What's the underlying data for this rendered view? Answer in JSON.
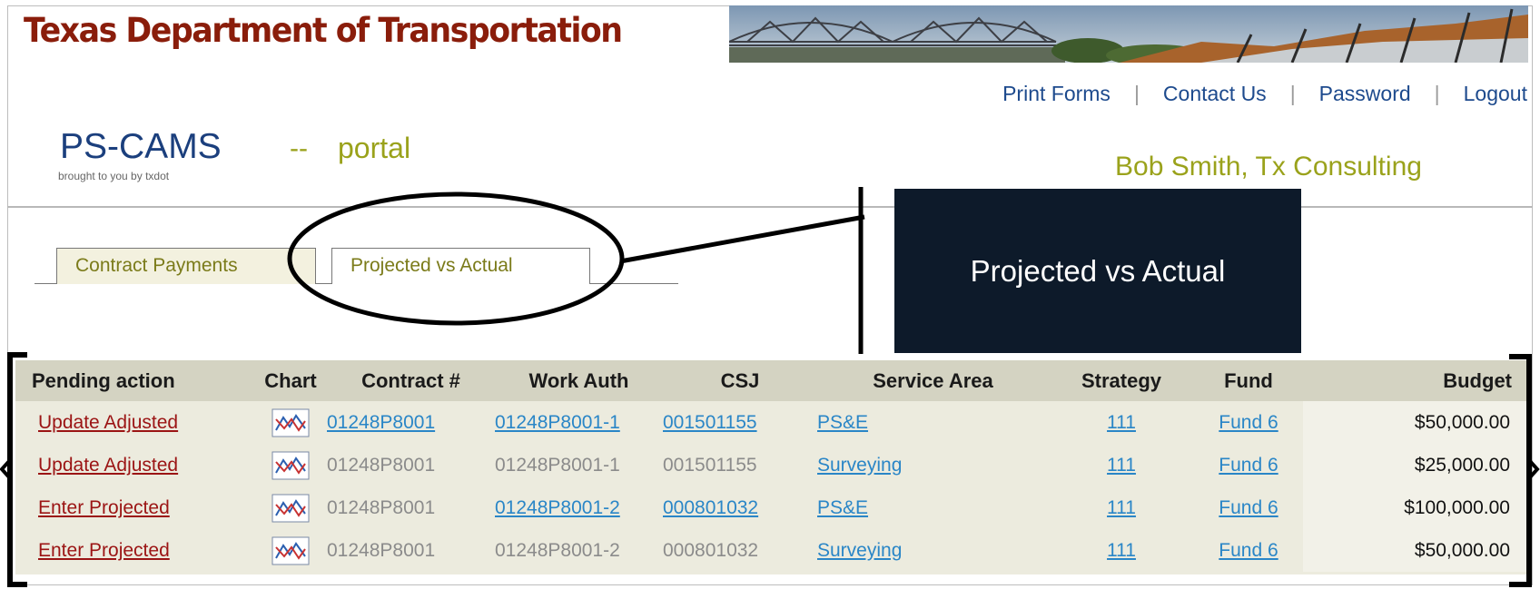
{
  "header": {
    "agency_title": "Texas Department of Transportation",
    "links": [
      "Print Forms",
      "Contact Us",
      "Password",
      "Logout"
    ],
    "app_name": "PS-CAMS",
    "app_dash": "--",
    "app_suffix": "portal",
    "app_subtitle": "brought to you by txdot",
    "user": "Bob Smith, Tx Consulting"
  },
  "tabs": [
    {
      "label": "Contract Payments",
      "active": false
    },
    {
      "label": "Projected vs Actual",
      "active": true
    }
  ],
  "callout": {
    "label": "Projected vs Actual"
  },
  "table": {
    "columns": [
      "Pending action",
      "Chart",
      "Contract #",
      "Work Auth",
      "CSJ",
      "Service Area",
      "Strategy",
      "Fund",
      "Budget"
    ],
    "rows": [
      {
        "action": "Update Adjusted",
        "contract": "01248P8001",
        "work_auth": "01248P8001-1",
        "csj": "001501155",
        "service_area": "PS&E",
        "strategy": "111",
        "fund": "Fund 6",
        "budget": "$50,000.00"
      },
      {
        "action": "Update Adjusted",
        "contract": "01248P8001",
        "work_auth": "01248P8001-1",
        "csj": "001501155",
        "service_area": "Surveying",
        "strategy": "111",
        "fund": "Fund 6",
        "budget": "$25,000.00"
      },
      {
        "action": "Enter Projected",
        "contract": "01248P8001",
        "work_auth": "01248P8001-2",
        "csj": "000801032",
        "service_area": "PS&E",
        "strategy": "111",
        "fund": "Fund 6",
        "budget": "$100,000.00"
      },
      {
        "action": "Enter Projected",
        "contract": "01248P8001",
        "work_auth": "01248P8001-2",
        "csj": "000801032",
        "service_area": "Surveying",
        "strategy": "111",
        "fund": "Fund 6",
        "budget": "$50,000.00"
      }
    ]
  },
  "icons": {
    "chart": "line-chart-icon"
  },
  "colors": {
    "agency_title": "#8a1d0b",
    "link_blue": "#2a86c7",
    "link_red": "#9b1414",
    "olive": "#9aa21b",
    "callout_bg": "#0d1a2a",
    "header_row": "#d4d3c2",
    "table_bg": "#ecebde"
  }
}
